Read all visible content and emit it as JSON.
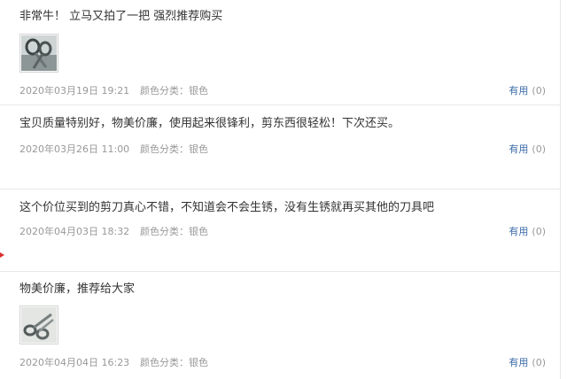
{
  "reviews": [
    {
      "text": "非常牛！ 立马又拍了一把 强烈推荐购买",
      "date": "2020年03月19日 19:21",
      "variant": "颜色分类：银色",
      "useful_label": "有用",
      "useful_count": "(0)",
      "thumbnail_icon": "scissors-photo"
    },
    {
      "text": "宝贝质量特别好，物美价廉，使用起来很锋利，剪东西很轻松！下次还买。",
      "date": "2020年03月26日 11:00",
      "variant": "颜色分类：银色",
      "useful_label": "有用",
      "useful_count": "(0)"
    },
    {
      "text": "这个价位买到的剪刀真心不错，不知道会不会生锈，没有生锈就再买其他的刀具吧",
      "date": "2020年04月03日 18:32",
      "variant": "颜色分类：银色",
      "useful_label": "有用",
      "useful_count": "(0)"
    },
    {
      "text": "物美价廉，推荐给大家",
      "date": "2020年04月04日 16:23",
      "variant": "颜色分类：银色",
      "useful_label": "有用",
      "useful_count": "(0)",
      "thumbnail_icon": "scissors-photo"
    }
  ],
  "colors": {
    "text": "#333333",
    "meta": "#999999",
    "link": "#3a6aa8",
    "divider": "#e8e8e8",
    "left_mark": "#d9302c"
  }
}
